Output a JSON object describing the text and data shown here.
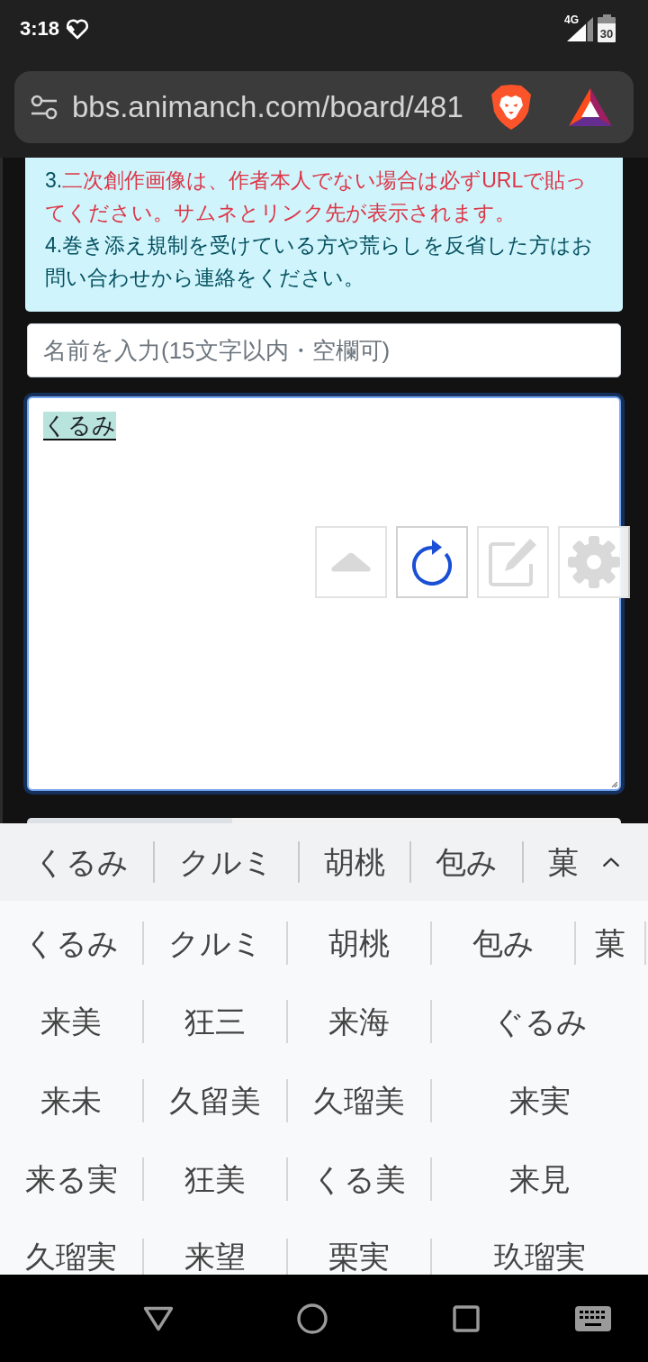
{
  "status_bar": {
    "time": "3:18",
    "network": "4G",
    "battery": "30"
  },
  "address_bar": {
    "url": "bbs.animanch.com/board/481"
  },
  "notice": {
    "items": [
      {
        "number": "3.",
        "text": "二次創作画像は、作者本人でない場合は必ずURLで貼ってください。サムネとリンク先が表示されます。",
        "emphasized": true
      },
      {
        "number": "4.",
        "text": "巻き添え規制を受けている方や荒らしを反省した方はお問い合わせから連絡をください。",
        "emphasized": false
      }
    ]
  },
  "name_field": {
    "placeholder": "名前を入力(15文字以内・空欄可)"
  },
  "comment_field": {
    "value": "くるみ",
    "composing": true,
    "focused": true
  },
  "floating_buttons": [
    {
      "kind": "scroll_top",
      "disabled": true
    },
    {
      "kind": "reload",
      "disabled": false
    },
    {
      "kind": "edit",
      "disabled": true
    },
    {
      "kind": "settings",
      "disabled": true
    }
  ],
  "keyboard": {
    "suggestions": [
      "くるみ",
      "クルミ",
      "胡桃",
      "包み",
      "菓"
    ],
    "candidates": [
      [
        "くるみ",
        "クルミ",
        "胡桃",
        "包み",
        "菓"
      ],
      [
        "来美",
        "狂三",
        "来海",
        "ぐるみ"
      ],
      [
        "来未",
        "久留美",
        "久瑠美",
        "来実"
      ],
      [
        "来る実",
        "狂美",
        "くる美",
        "来見"
      ],
      [
        "久瑠実",
        "来望",
        "栗実",
        "玖瑠実"
      ]
    ]
  }
}
